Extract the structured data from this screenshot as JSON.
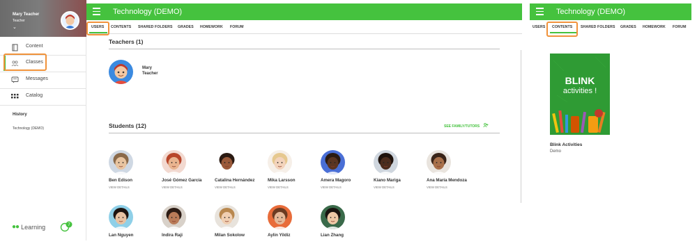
{
  "sidebar": {
    "profile_name": "Mary Teacher",
    "profile_role": "Teacher",
    "profile_caret": "⌄",
    "nav": [
      {
        "label": "Content",
        "icon": "content-icon"
      },
      {
        "label": "Classes",
        "icon": "classes-icon"
      },
      {
        "label": "Messages",
        "icon": "messages-icon"
      },
      {
        "label": "Catalog",
        "icon": "catalog-icon"
      }
    ],
    "history_title": "History",
    "history_items": [
      "Technology (DEMO)"
    ],
    "learning_label": "Learning",
    "chat_badge": "7"
  },
  "main": {
    "title": "Technology (DEMO)",
    "tabs": [
      "USERS",
      "CONTENTS",
      "SHARED FOLDERS",
      "GRADES",
      "HOMEWORK",
      "FORUM"
    ],
    "active_tab": "USERS",
    "teachers_title": "Teachers (1)",
    "teacher": {
      "name": "Mary",
      "role": "Teacher"
    },
    "students_title": "Students (12)",
    "see_family_label": "SEE FAMILY/TUTORS",
    "view_details_label": "VIEW DETAILS",
    "students": [
      {
        "name": "Ben Edison",
        "skin": "#e8c4a0",
        "hair": "#8a6a4a",
        "bg": "#cfd8e3"
      },
      {
        "name": "José Gómez García",
        "skin": "#e9b48f",
        "hair": "#b8462a",
        "bg": "#f2d9d0"
      },
      {
        "name": "Catalina Hernández",
        "skin": "#9a5a3a",
        "hair": "#2a1a12",
        "bg": "#ffffff"
      },
      {
        "name": "Mika Larsson",
        "skin": "#f3d3bc",
        "hair": "#e6c88f",
        "bg": "#f6efe8"
      },
      {
        "name": "Amera Magoro",
        "skin": "#5a3522",
        "hair": "#2a1a12",
        "bg": "#4a6fd6"
      },
      {
        "name": "Kiano Mariga",
        "skin": "#4b2c1c",
        "hair": "#1e120c",
        "bg": "#cfd6de"
      },
      {
        "name": "Ana María Mendoza",
        "skin": "#a8704a",
        "hair": "#3a2418",
        "bg": "#e9e4de"
      },
      {
        "name": "Lan Nguyen",
        "skin": "#e7c2a2",
        "hair": "#1d1410",
        "bg": "#8fd0e8"
      },
      {
        "name": "Indira Raji",
        "skin": "#b97b58",
        "hair": "#2c1b14",
        "bg": "#d8d1c9"
      },
      {
        "name": "Milan Sokolow",
        "skin": "#f0cfb2",
        "hair": "#b9884f",
        "bg": "#e8e3dc"
      },
      {
        "name": "Aylin Yildiz",
        "skin": "#e4b898",
        "hair": "#6b3b22",
        "bg": "#e86c3a"
      },
      {
        "name": "Lian Zhang",
        "skin": "#edc8a6",
        "hair": "#1a1410",
        "bg": "#3a6a4a"
      }
    ]
  },
  "right": {
    "title": "Technology (DEMO)",
    "tabs": [
      "USERS",
      "CONTENTS",
      "SHARED FOLDERS",
      "GRADES",
      "HOMEWORK",
      "FORUM"
    ],
    "active_tab": "CONTENTS",
    "book_cover_title": "BLINK",
    "book_cover_sub": "activities !",
    "book_title": "Blink Activities",
    "book_owner": "Demo"
  },
  "colors": {
    "brand_green": "#45c23e",
    "highlight_orange": "#f0923a"
  }
}
